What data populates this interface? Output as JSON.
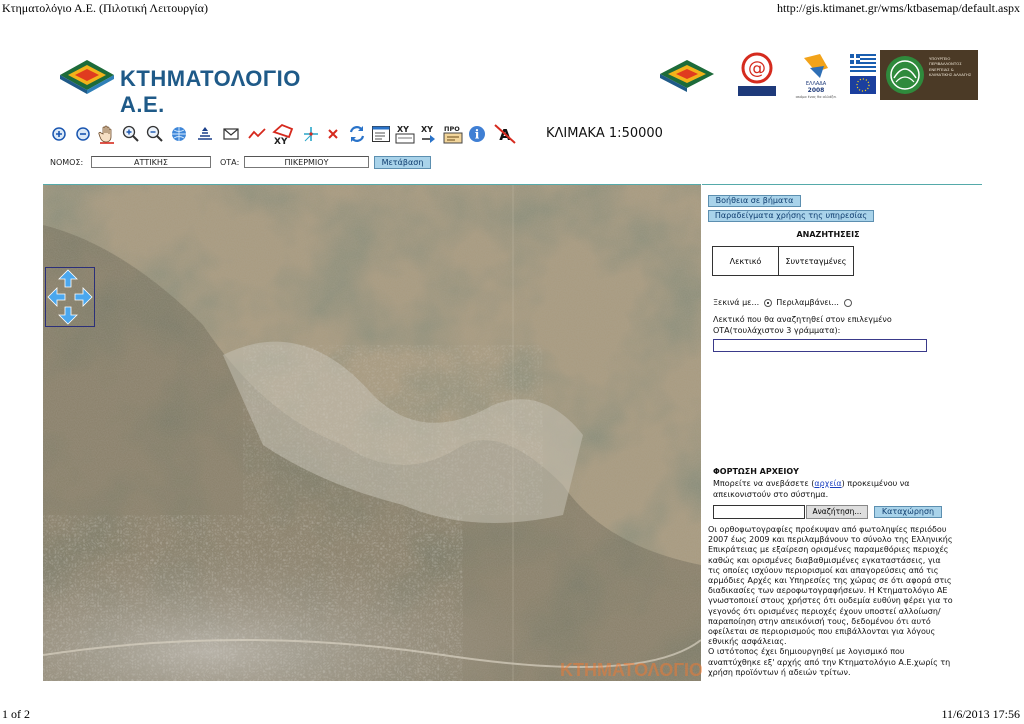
{
  "page": {
    "header_title": "Κτηματολόγιο Α.Ε. (Πιλοτική Λειτουργία)",
    "header_url": "http://gis.ktimanet.gr/wms/ktbasemap/default.aspx",
    "footer_page": "1 of 2",
    "footer_datetime": "11/6/2013 17:56"
  },
  "brand": {
    "logo_text": "ΚΤΗΜΑΤΟΛΟΓΙΟ Α.Ε.",
    "ministry_text": "ΥΠΟΥΡΓΕΙΟ ΠΕΡΙΒΑΛΛΟΝΤΟΣ ΕΝΕΡΓΕΙΑΣ & ΚΛΙΜΑΤΙΚΗΣ ΑΛΛΑΓΗΣ",
    "ellada_label": "ΕΛΛΑΔΑ",
    "ellada_year": "2008",
    "ellada_sub": "ακόμα ένας θα αλλάξει"
  },
  "toolbar": {
    "tools": [
      "zoom-in-icon",
      "zoom-out-icon",
      "pan-hand-icon",
      "zoom-box-in-icon",
      "zoom-box-out-icon",
      "full-extent-icon",
      "identify-layers-icon",
      "envelope-icon",
      "measure-line-icon",
      "xy-locate-icon",
      "point-draw-icon",
      "clear-icon",
      "refresh-icon",
      "legend-window-icon",
      "xy-coordinates-icon",
      "xy-goto-icon",
      "print-icon",
      "info-icon",
      "label-toggle-icon"
    ],
    "xy_label": "XY",
    "print_label": "ΠΡΟ",
    "scale_text": "ΚΛΙΜΑΚΑ 1:50000"
  },
  "nav": {
    "nomos_label": "ΝΟΜΟΣ:",
    "nomos_value": "ΑΤΤΙΚΗΣ",
    "ota_label": "ΟΤΑ:",
    "ota_value": "ΠΙΚΕΡΜΙΟΥ",
    "go_button": "Μετάβαση"
  },
  "map": {
    "watermark": "ΚΤΗΜΑΤΟΛΟΓΙΟ"
  },
  "panel": {
    "help_button": "Βοήθεια σε βήματα",
    "examples_button": "Παραδείγματα χρήσης της υπηρεσίας",
    "search_title": "ΑΝΑΖΗΤΗΣΕΙΣ",
    "tab_text": "Λεκτικό",
    "tab_coords": "Συντεταγμένες",
    "radio_starts": "Ξεκινά με...",
    "radio_contains": "Περιλαμβάνει...",
    "search_hint": "Λεκτικό που θα αναζητηθεί στον επιλεγμένο ΟΤΑ(τουλάχιστον 3 γράμματα):",
    "search_value": "",
    "upload_title": "ΦΟΡΤΩΣΗ ΑΡΧΕΙΟΥ",
    "upload_text_before": "Μπορείτε να ανεβάσετε (",
    "upload_link": "αρχεία",
    "upload_text_after": ") προκειμένου να απεικονιστούν στο σύστημα.",
    "file_value": "",
    "browse_button": "Αναζήτηση...",
    "submit_button": "Καταχώρηση",
    "disclaimer": "Οι ορθοφωτογραφίες προέκυψαν από φωτοληψίες περιόδου 2007 έως 2009 και περιλαμβάνουν το σύνολο της Ελληνικής Επικράτειας με εξαίρεση ορισμένες παραμεθόριες περιοχές καθώς και ορισμένες διαβαθμισμένες εγκαταστάσεις, για τις οποίες ισχύουν περιορισμοί και απαγορεύσεις από τις αρμόδιες Αρχές και Υπηρεσίες της χώρας σε ότι αφορά στις διαδικασίες των αεροφωτογραφήσεων. Η Κτηματολόγιο ΑΕ γνωστοποιεί στους χρήστες ότι ουδεμία ευθύνη φέρει για το γεγονός ότι ορισμένες περιοχές έχουν υποστεί αλλοίωση/παραποίηση στην απεικόνισή τους, δεδομένου ότι αυτό οφείλεται σε περιορισμούς που επιβάλλονται για λόγους εθνικής ασφάλειας.",
    "disclaimer2": "Ο ιστότοπος έχει δημιουργηθεί με λογισμικό που αναπτύχθηκε εξ' αρχής από την Κτηματολόγιο Α.Ε.χωρίς τη χρήση προϊόντων ή αδειών τρίτων."
  },
  "colors": {
    "button_bg": "#a9d3ea",
    "logo_blue": "#1f5a88"
  }
}
